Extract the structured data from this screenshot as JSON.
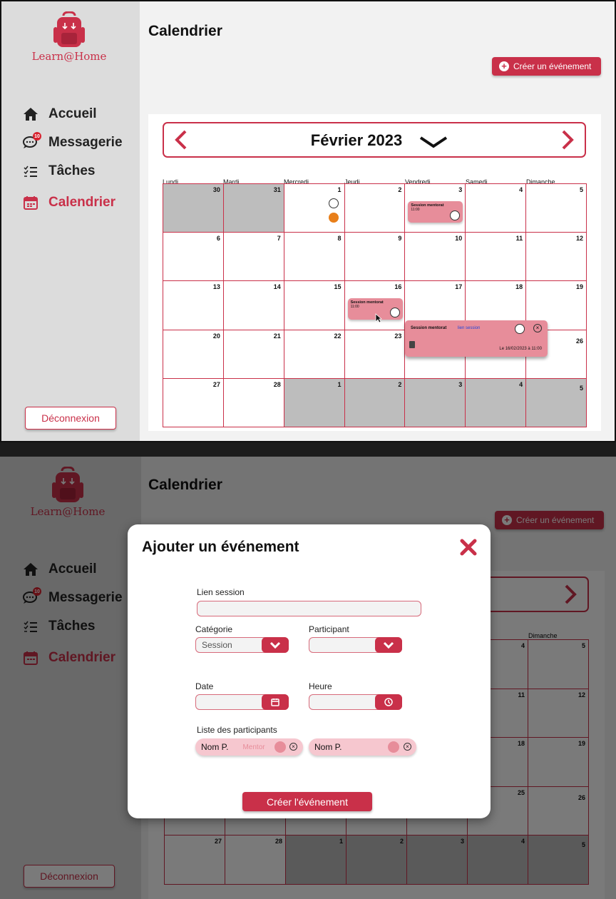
{
  "app": {
    "name": "Learn@Home",
    "page_title": "Calendrier"
  },
  "sidebar": {
    "items": [
      {
        "label": "Accueil",
        "icon": "home-icon"
      },
      {
        "label": "Messagerie",
        "icon": "chat-icon",
        "badge": "10"
      },
      {
        "label": "Tâches",
        "icon": "tasks-icon"
      },
      {
        "label": "Calendrier",
        "icon": "calendar-icon",
        "active": true
      }
    ],
    "logout_label": "Déconnexion"
  },
  "toolbar": {
    "create_event_label": "Créer un événement"
  },
  "calendar": {
    "month_label": "Février 2023",
    "day_headers": [
      "Lundi",
      "Mardi",
      "Mercredi",
      "Jeudi",
      "Vendredi",
      "Samedi",
      "Dimanche"
    ],
    "weeks": [
      [
        "30",
        "31",
        "1",
        "2",
        "3",
        "4",
        "5"
      ],
      [
        "6",
        "7",
        "8",
        "9",
        "10",
        "11",
        "12"
      ],
      [
        "13",
        "14",
        "15",
        "16",
        "17",
        "18",
        "19"
      ],
      [
        "20",
        "21",
        "22",
        "23",
        "24",
        "25",
        "26"
      ],
      [
        "27",
        "28",
        "1",
        "2",
        "3",
        "4",
        "5"
      ]
    ],
    "events": [
      {
        "title": "Session mentorat",
        "time": "11:00"
      },
      {
        "title": "Session mentorat",
        "time": "11:00"
      }
    ],
    "popup": {
      "title": "Session mentorat",
      "link": "lien session",
      "date": "Le 16/02/2023 à 11:00"
    }
  },
  "modal": {
    "title": "Ajouter un événement",
    "lien_session_label": "Lien session",
    "categorie_label": "Catégorie",
    "categorie_value": "Session",
    "participant_label": "Participant",
    "date_label": "Date",
    "heure_label": "Heure",
    "liste_label": "Liste des participants",
    "chips": [
      {
        "name": "Nom P.",
        "role": "Mentor"
      },
      {
        "name": "Nom P.",
        "role": ""
      }
    ],
    "submit_label": "Créer l'événement"
  },
  "colors": {
    "accent": "#c93049",
    "event_bg": "#e78d9a",
    "sidebar_bg": "#dcdcdc"
  }
}
